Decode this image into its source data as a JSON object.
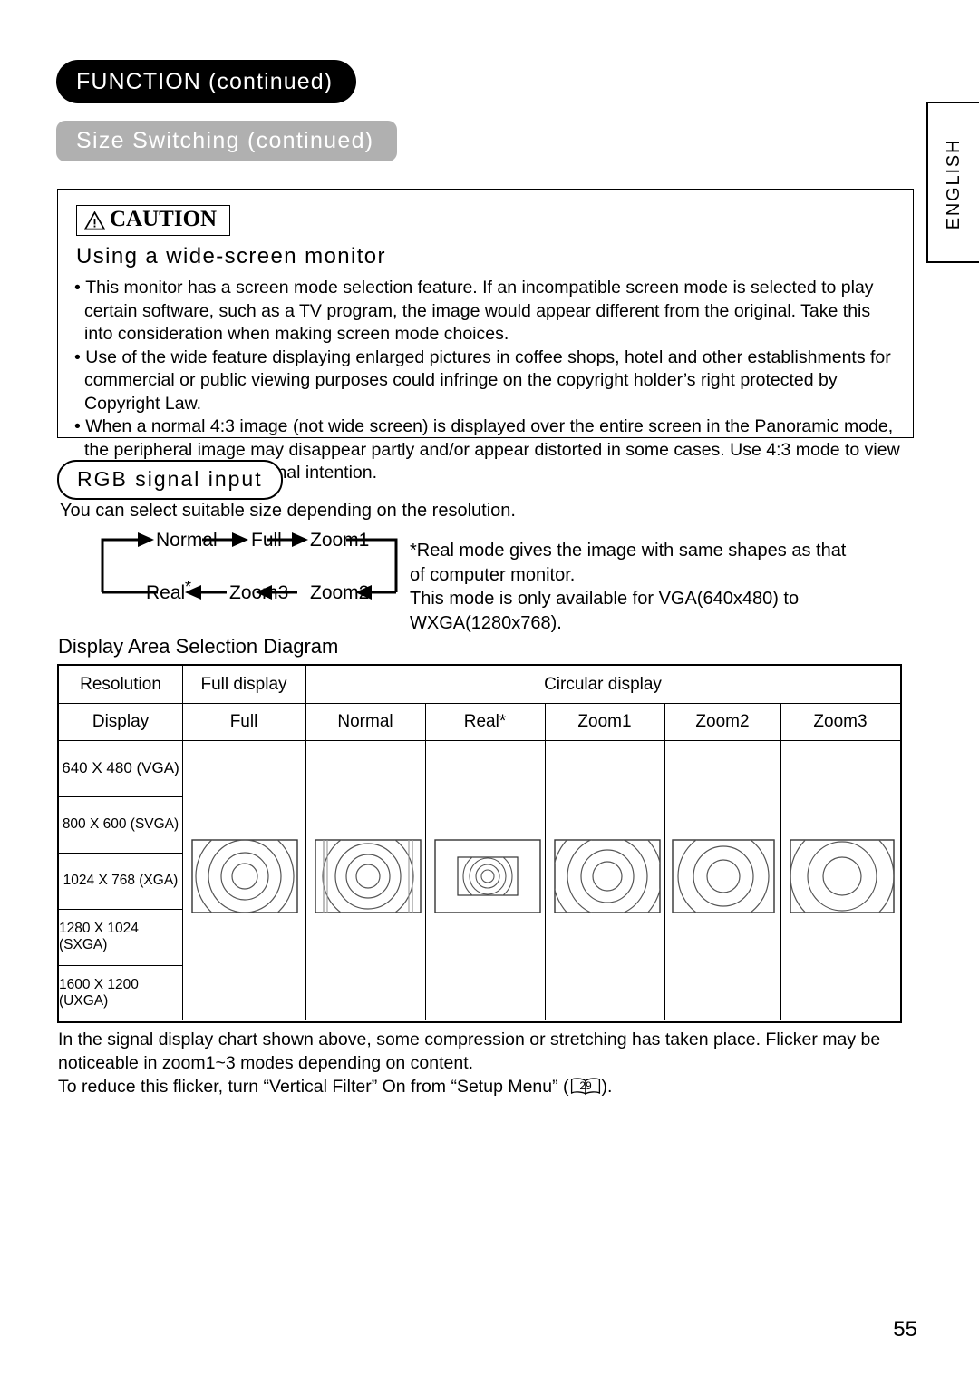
{
  "header": {
    "section_title": "FUNCTION (continued)",
    "subsection_title": "Size Switching (continued)"
  },
  "side_tab": {
    "label": "ENGLISH"
  },
  "caution": {
    "badge_label": "CAUTION",
    "badge_icon": "warning-triangle-icon",
    "subtitle": "Using a wide-screen monitor",
    "bullets": [
      "This monitor has a screen mode selection feature. If an incompatible screen mode is selected to play certain software, such as a TV program, the image would appear different from the original. Take this into consideration when making screen mode choices.",
      "Use of the wide feature displaying enlarged pictures in coffee shops, hotel and other establishments for commercial or public viewing purposes could infringe on the copyright holder’s right protected by Copyright Law.",
      "When a normal 4:3 image (not wide screen) is displayed over the entire screen in the Panoramic mode, the peripheral image may disappear partly and/or appear distorted in some cases. Use 4:3 mode to view the image reflecting original intention."
    ]
  },
  "rgb_section": {
    "pill_label": "RGB signal input",
    "description": "You can select suitable size depending on the resolution.",
    "flow": {
      "top_row": [
        "Normal",
        "Full",
        "Zoom1"
      ],
      "bottom_row": [
        "Real*",
        "Zoom3",
        "Zoom2"
      ]
    },
    "note": "*Real mode gives the image with same shapes as that\n of computer monitor.\n This mode is only available for VGA(640x480) to\n WXGA(1280x768)."
  },
  "table": {
    "title": "Display Area Selection Diagram",
    "header_row1": {
      "resolution": "Resolution",
      "full_display": "Full display",
      "circular_display": "Circular display"
    },
    "header_row2": [
      "Display",
      "Full",
      "Normal",
      "Real*",
      "Zoom1",
      "Zoom2",
      "Zoom3"
    ],
    "resolutions": [
      "640 X 480 (VGA)",
      "800 X 600 (SVGA)",
      "1024 X 768 (XGA)",
      "1280 X 1024 (SXGA)",
      "1600 X 1200 (UXGA)"
    ],
    "figure_modes": [
      "Full",
      "Normal",
      "Real*",
      "Zoom1",
      "Zoom2",
      "Zoom3"
    ]
  },
  "bottom_note": {
    "line1": "In the signal display chart shown above, some compression or stretching has taken place. Flicker may be noticeable in zoom1~3 modes depending on content.",
    "line2_part1": "To reduce this flicker, turn “Vertical Filter” On from “Setup Menu” (",
    "page_ref": "29",
    "line2_part2": ").",
    "ref_icon": "open-book-icon"
  },
  "page_number": "55",
  "colors": {
    "ink": "#000000",
    "gray_pill": "#b0b0b0",
    "figure_line": "#444444"
  }
}
